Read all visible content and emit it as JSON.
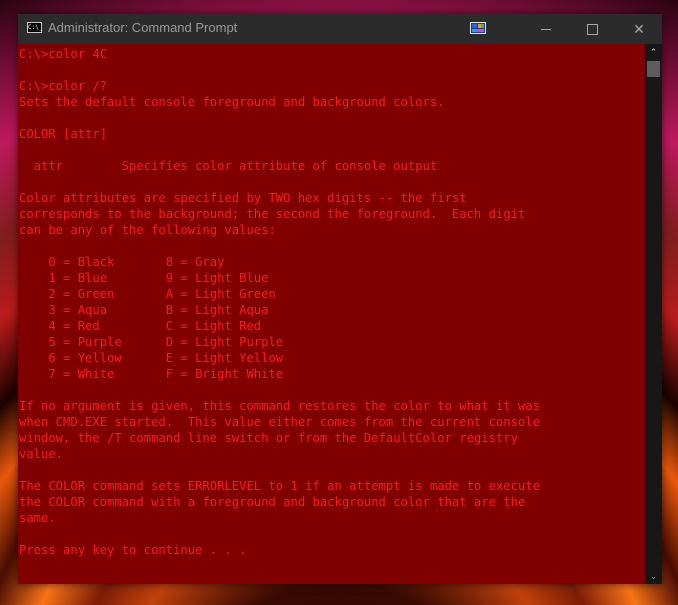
{
  "window": {
    "title": "Administrator: Command Prompt",
    "app_icon": "cmd-icon",
    "app_icon_text": "C:\\_",
    "controls": {
      "minimize": "minimize-icon",
      "maximize": "maximize-icon",
      "close_symbol": "✕"
    }
  },
  "colors": {
    "console_background": "#800000",
    "console_foreground": "#ff1a1a",
    "titlebar": "#2b2b2b"
  },
  "console": {
    "lines": [
      "C:\\>color 4C",
      "",
      "C:\\>color /?",
      "Sets the default console foreground and background colors.",
      "",
      "COLOR [attr]",
      "",
      "  attr        Specifies color attribute of console output",
      "",
      "Color attributes are specified by TWO hex digits -- the first",
      "corresponds to the background; the second the foreground.  Each digit",
      "can be any of the following values:",
      "",
      "    0 = Black       8 = Gray",
      "    1 = Blue        9 = Light Blue",
      "    2 = Green       A = Light Green",
      "    3 = Aqua        B = Light Aqua",
      "    4 = Red         C = Light Red",
      "    5 = Purple      D = Light Purple",
      "    6 = Yellow      E = Light Yellow",
      "    7 = White       F = Bright White",
      "",
      "If no argument is given, this command restores the color to what it was",
      "when CMD.EXE started.  This value either comes from the current console",
      "window, the /T command line switch or from the DefaultColor registry",
      "value.",
      "",
      "The COLOR command sets ERRORLEVEL to 1 if an attempt is made to execute",
      "the COLOR command with a foreground and background color that are the",
      "same.",
      "",
      "Press any key to continue . . ."
    ]
  },
  "scrollbar": {
    "up_arrow": "⌃",
    "down_arrow": "⌄"
  }
}
